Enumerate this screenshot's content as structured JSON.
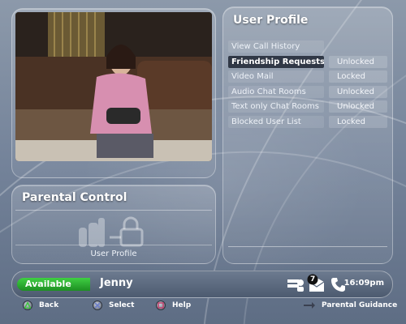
{
  "profile": {
    "title": "User Profile",
    "items": [
      {
        "label": "View Call History",
        "status": "",
        "selected": false
      },
      {
        "label": "Friendship Requests",
        "status": "Unlocked",
        "selected": true
      },
      {
        "label": "Video Mail",
        "status": "Locked",
        "selected": false
      },
      {
        "label": "Audio Chat Rooms",
        "status": "Unlocked",
        "selected": false
      },
      {
        "label": "Text only Chat Rooms",
        "status": "Unlocked",
        "selected": false
      },
      {
        "label": "Blocked User List",
        "status": "Locked",
        "selected": false
      }
    ]
  },
  "parental": {
    "title": "Parental Control",
    "bottom_label": "User Profile"
  },
  "statusbar": {
    "availability": "Available",
    "username": "Jenny",
    "message_count": "7",
    "time": "16:09pm",
    "icons": [
      "friends-icon",
      "mail-icon",
      "phone-icon"
    ]
  },
  "footer": {
    "back": "Back",
    "select": "Select",
    "help": "Help",
    "guidance": "Parental Guidance"
  },
  "colors": {
    "available": "#2fb534",
    "button_a": "#3cc53c",
    "button_x": "#6c7ec8",
    "button_help": "#c83c6a"
  }
}
